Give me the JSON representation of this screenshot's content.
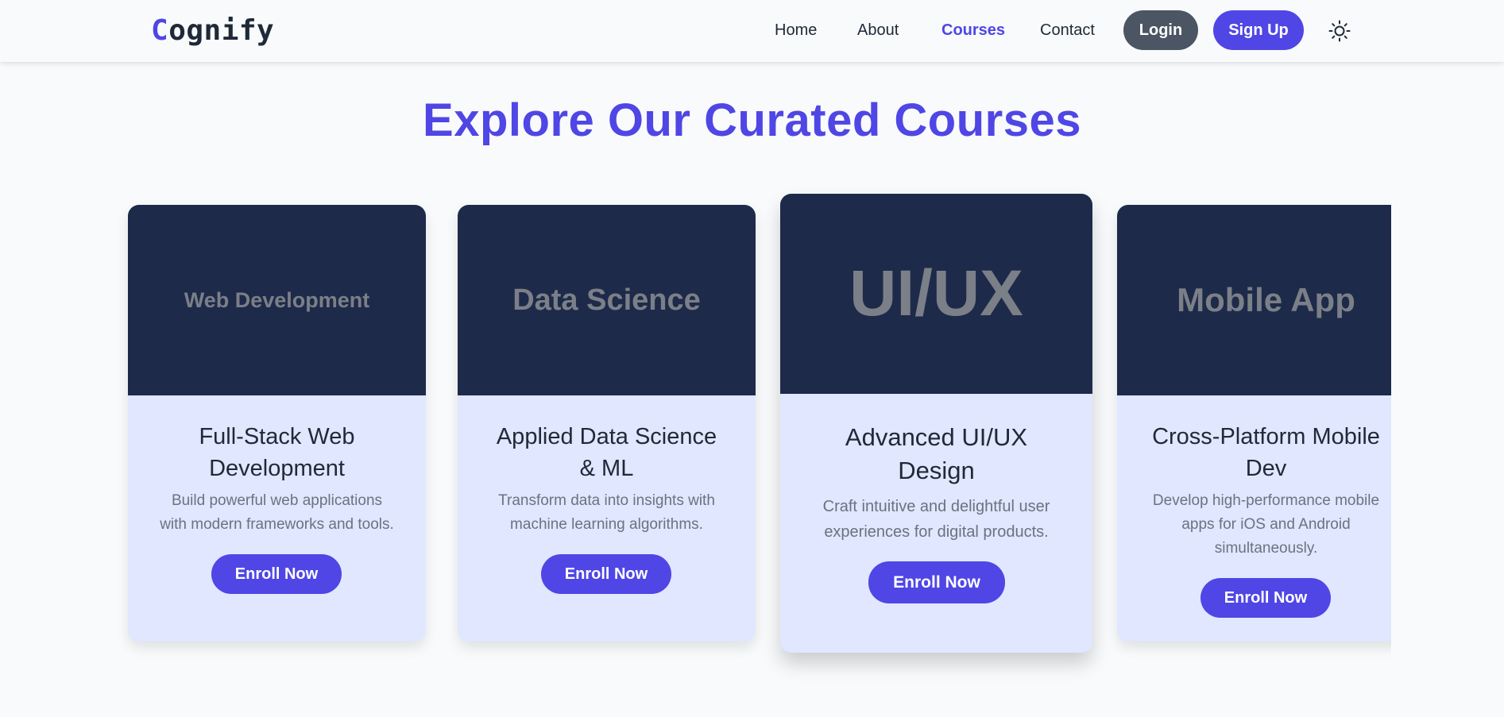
{
  "colors": {
    "accent": "#4f46e5",
    "login_bg": "#4b5563",
    "banner_bg": "#1e2a4a",
    "card_bg": "#e0e7ff",
    "page_bg": "#f8fafc"
  },
  "header": {
    "logo_first": "C",
    "logo_rest": "ognify",
    "nav": [
      {
        "label": "Home"
      },
      {
        "label": "About"
      },
      {
        "label": "Courses"
      },
      {
        "label": "Contact"
      }
    ],
    "login_label": "Login",
    "signup_label": "Sign Up",
    "theme_icon": "sun-icon"
  },
  "main": {
    "title": "Explore Our Curated Courses",
    "courses": [
      {
        "banner": "Web Development",
        "title": "Full-Stack Web Development",
        "title_line1": "Full-Stack Web",
        "title_line2": "Development",
        "desc_line1": "Build powerful web applications",
        "desc_line2": "with modern frameworks and tools.",
        "button": "Enroll Now"
      },
      {
        "banner": "Data Science",
        "title": "Applied Data Science & ML",
        "title_line1": "Applied Data Science",
        "title_line2": "& ML",
        "desc_line1": "Transform data into insights with",
        "desc_line2": "machine learning algorithms.",
        "button": "Enroll Now"
      },
      {
        "banner": "UI/UX",
        "title": "Advanced UI/UX Design",
        "title_line1": "Advanced UI/UX",
        "title_line2": "Design",
        "desc_line1": "Craft intuitive and delightful user",
        "desc_line2": "experiences for digital products.",
        "button": "Enroll Now"
      },
      {
        "banner": "Mobile App",
        "title": "Cross-Platform Mobile Dev",
        "title_line1": "Cross-Platform Mobile",
        "title_line2": "Dev",
        "desc_line1": "Develop high-performance mobile",
        "desc_line2": "apps for iOS and Android",
        "desc_line3": "simultaneously.",
        "button": "Enroll Now"
      }
    ]
  }
}
